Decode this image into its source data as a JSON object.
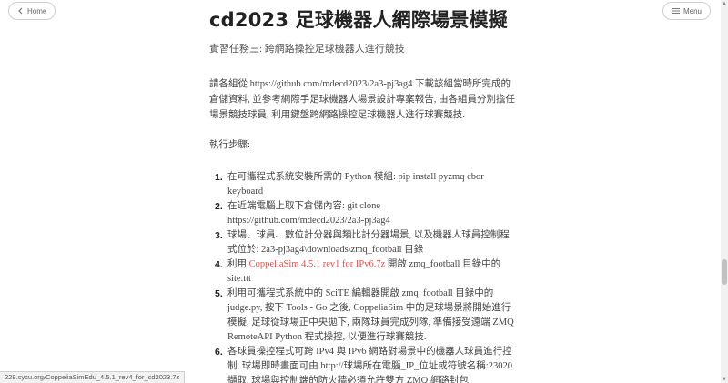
{
  "nav": {
    "home_label": "Home",
    "menu_label": "Menu"
  },
  "page": {
    "title": "cd2023 足球機器人網際場景模擬",
    "subtitle": "實習任務三: 跨網路操控足球機器人進行競技",
    "intro": "請各組從 https://github.com/mdecd2023/2a3-pj3ag4 下載該組當時所完成的倉儲資料, 並參考網際手足球機器人場景設計專案報告, 由各組員分別擔任場景競技球員, 利用鍵盤跨網路操控足球機器人進行球賽競技.",
    "steps_heading": "執行步驟:"
  },
  "steps": [
    {
      "num": "1.",
      "text": "在可攜程式系統安裝所需的 Python 模組: pip install pyzmq cbor keyboard"
    },
    {
      "num": "2.",
      "text": "在近端電腦上取下倉儲內容: git clone https://github.com/mdecd2023/2a3-pj3ag4"
    },
    {
      "num": "3.",
      "text": "球場、球員、數位計分器與類比計分器場景, 以及機器人球員控制程式位於: 2a3-pj3ag4\\downloads\\zmq_football 目錄"
    },
    {
      "num": "4.",
      "pre": "利用 ",
      "link": "CoppeliaSim 4.5.1 rev1 for IPv6.7z",
      "post": " 開啟 zmq_football 目錄中的 site.ttt"
    },
    {
      "num": "5.",
      "text": "利用可攜程式系統中的 SciTE 編輯器開啟 zmq_football 目錄中的 judge.py, 按下 Tools - Go 之後, CoppeliaSim 中的足球場景將開始進行模擬, 足球從球場正中央拋下, 兩隊球員完成列隊, 準備接受遠端 ZMQ RemoteAPI Python 程式操控, 以便進行球賽競技."
    },
    {
      "num": "6.",
      "text": "各球員操控程式可跨 IPv4 與 IPv6 網路對場景中的機器人球員進行控制, 球場即時畫面可由 http://球場所在電腦_IP_位址或符號名稱:23020 擷取, 球場與控制端的防火牆必須允許雙方 ZMQ 網路封包"
    }
  ],
  "status_bar": {
    "url": "229.cycu.org/CoppeliaSimEdu_4.5.1_rev4_for_cd2023.7z"
  },
  "colors": {
    "link": "#d9534f",
    "text": "#444444",
    "title": "#222222"
  }
}
